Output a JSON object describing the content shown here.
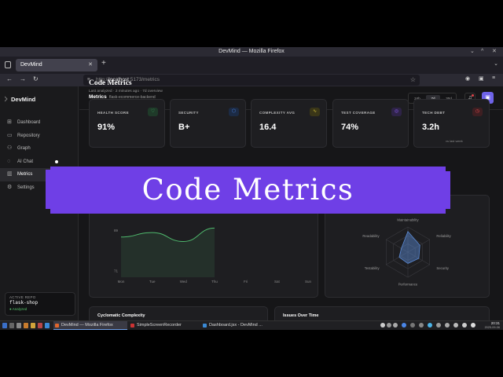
{
  "browser": {
    "window_title": "DevMind — Mozilla Firefox",
    "tab_title": "DevMind",
    "url_host": "localhost",
    "url_rest": ":5173/metrics",
    "url_scheme": "http://"
  },
  "sidebar": {
    "brand": "DevMind",
    "items": [
      {
        "label": "Dashboard",
        "icon": "grid-icon"
      },
      {
        "label": "Repository",
        "icon": "folder-icon"
      },
      {
        "label": "Graph",
        "icon": "graph-icon"
      },
      {
        "label": "AI Chat",
        "icon": "chat-icon"
      },
      {
        "label": "Metrics",
        "icon": "chart-icon"
      },
      {
        "label": "Settings",
        "icon": "gear-icon"
      }
    ],
    "active_repo_label": "ACTIVE REPO",
    "active_repo_name": "flask-shop",
    "active_repo_status": "● Analyzed"
  },
  "topbar": {
    "title": "Metrics",
    "repo": "flask-ecommerce-backend",
    "ranges": [
      "24h",
      "7d",
      "30d"
    ],
    "selected_range": "7d",
    "avatar": "▣"
  },
  "page": {
    "title": "Code Metrics",
    "subtitle": "Last analyzed · 2 minutes ago · 7d overview"
  },
  "metric_cards": [
    {
      "label": "HEALTH SCORE",
      "value": "91%",
      "sub": "",
      "icon": "heart-icon",
      "color": "#3fbf6b"
    },
    {
      "label": "SECURITY",
      "value": "B+",
      "sub": "",
      "icon": "shield-icon",
      "color": "#4a86e8"
    },
    {
      "label": "COMPLEXITY AVG",
      "value": "16.4",
      "sub": "",
      "icon": "pulse-icon",
      "color": "#d7c43a"
    },
    {
      "label": "TEST COVERAGE",
      "value": "74%",
      "sub": "",
      "icon": "target-icon",
      "color": "#8b5cf6"
    },
    {
      "label": "TECH DEBT",
      "value": "3.2h",
      "sub": "vs last week",
      "icon": "clock-icon",
      "color": "#e0454a"
    }
  ],
  "banner": {
    "text": "Code Metrics",
    "color": "#6f3fe6"
  },
  "panels": {
    "cyclomatic": "Cyclomatic Complexity",
    "issues": "Issues Over Time"
  },
  "chart_data": [
    {
      "type": "area",
      "title": "",
      "categories": [
        "Mon",
        "Tue",
        "Wed",
        "Thu",
        "Fri",
        "Sat",
        "Sun"
      ],
      "series": [
        {
          "values": [
            86,
            88,
            84,
            90,
            null,
            null,
            null
          ]
        }
      ],
      "yticks": [
        89,
        71
      ],
      "ylabel_partial": [
        "89",
        "71"
      ],
      "color": "#4fb96d"
    },
    {
      "type": "radar",
      "title": "",
      "categories": [
        "Maintainability",
        "Reliability",
        "Security",
        "Performance",
        "Testability",
        "Readability"
      ],
      "series": [
        {
          "values": [
            0.82,
            0.55,
            0.5,
            0.45,
            0.4,
            0.3
          ]
        }
      ],
      "color": "#5b8bd6"
    }
  ],
  "taskbar": {
    "tasks": [
      "DevMind — Mozilla Firefox",
      "SimpleScreenRecorder",
      "Dashboard.jsx - DevMind ..."
    ],
    "time": "20:31",
    "date": "2025-09-06"
  }
}
